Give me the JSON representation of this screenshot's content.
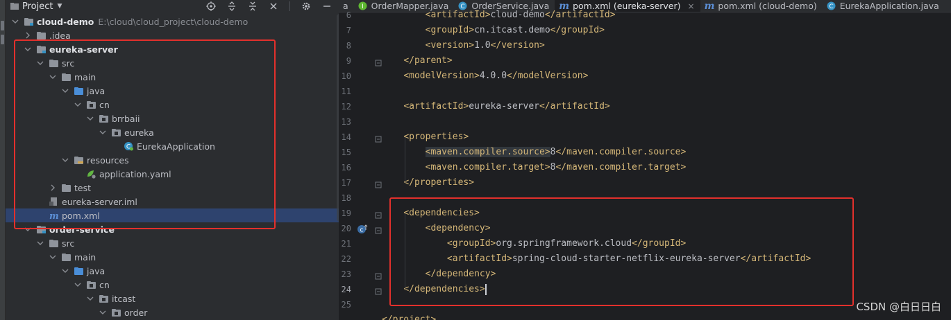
{
  "project_panel": {
    "title": "Project",
    "tree": [
      {
        "label": "cloud-demo",
        "path": "E:\\cloud\\cloud_project\\cloud-demo",
        "bold": true,
        "icon": "module-folder-icon",
        "expanded": true,
        "depth": 0
      },
      {
        "label": ".idea",
        "icon": "folder-icon",
        "expanded": false,
        "depth": 1
      },
      {
        "label": "eureka-server",
        "bold": true,
        "icon": "module-folder-icon",
        "expanded": true,
        "depth": 1
      },
      {
        "label": "src",
        "icon": "folder-icon",
        "expanded": true,
        "depth": 2
      },
      {
        "label": "main",
        "icon": "folder-icon",
        "expanded": true,
        "depth": 3
      },
      {
        "label": "java",
        "icon": "source-folder-icon",
        "expanded": true,
        "depth": 4
      },
      {
        "label": "cn",
        "icon": "package-icon",
        "expanded": true,
        "depth": 5
      },
      {
        "label": "brrbaii",
        "icon": "package-icon",
        "expanded": true,
        "depth": 6
      },
      {
        "label": "eureka",
        "icon": "package-icon",
        "expanded": true,
        "depth": 7
      },
      {
        "label": "EurekaApplication",
        "icon": "spring-class-icon",
        "depth": 8
      },
      {
        "label": "resources",
        "icon": "resources-folder-icon",
        "expanded": true,
        "depth": 4
      },
      {
        "label": "application.yaml",
        "icon": "yaml-spring-icon",
        "depth": 5
      },
      {
        "label": "test",
        "icon": "folder-icon",
        "expanded": false,
        "depth": 3
      },
      {
        "label": "eureka-server.iml",
        "icon": "iml-file-icon",
        "depth": 2
      },
      {
        "label": "pom.xml",
        "icon": "maven-file-icon",
        "depth": 2,
        "selected": true
      },
      {
        "label": "order-service",
        "bold": true,
        "icon": "module-folder-icon",
        "expanded": true,
        "depth": 1
      },
      {
        "label": "src",
        "icon": "folder-icon",
        "expanded": true,
        "depth": 2
      },
      {
        "label": "main",
        "icon": "folder-icon",
        "expanded": true,
        "depth": 3
      },
      {
        "label": "java",
        "icon": "source-folder-icon",
        "expanded": true,
        "depth": 4
      },
      {
        "label": "cn",
        "icon": "package-icon",
        "expanded": true,
        "depth": 5
      },
      {
        "label": "itcast",
        "icon": "package-icon",
        "expanded": true,
        "depth": 6
      },
      {
        "label": "order",
        "icon": "package-icon",
        "expanded": true,
        "depth": 7
      }
    ]
  },
  "editor": {
    "tabs": [
      {
        "label": "a",
        "icon": "none"
      },
      {
        "label": "OrderMapper.java",
        "icon": "interface-icon",
        "color": "#5fb832"
      },
      {
        "label": "OrderService.java",
        "icon": "class-icon",
        "color": "#3592c4"
      },
      {
        "label": "pom.xml (eureka-server)",
        "icon": "maven-m-icon",
        "active": true
      },
      {
        "label": "pom.xml (cloud-demo)",
        "icon": "maven-m-icon"
      },
      {
        "label": "EurekaApplication.java",
        "icon": "spring-class-icon",
        "color": "#3592c4"
      }
    ],
    "lines": [
      {
        "num": "6",
        "code": "        <artifactId>cloud-demo</artifactId>"
      },
      {
        "num": "7",
        "code": "        <groupId>cn.itcast.demo</groupId>"
      },
      {
        "num": "8",
        "code": "        <version>1.0</version>"
      },
      {
        "num": "9",
        "code": "    </parent>"
      },
      {
        "num": "10",
        "code": "    <modelVersion>4.0.0</modelVersion>"
      },
      {
        "num": "11",
        "code": ""
      },
      {
        "num": "12",
        "code": "    <artifactId>eureka-server</artifactId>"
      },
      {
        "num": "13",
        "code": ""
      },
      {
        "num": "14",
        "code": "    <properties>"
      },
      {
        "num": "15",
        "code": "        <maven.compiler.source>8</maven.compiler.source>"
      },
      {
        "num": "16",
        "code": "        <maven.compiler.target>8</maven.compiler.target>"
      },
      {
        "num": "17",
        "code": "    </properties>"
      },
      {
        "num": "18",
        "code": ""
      },
      {
        "num": "19",
        "code": "    <dependencies>"
      },
      {
        "num": "20",
        "code": "        <dependency>"
      },
      {
        "num": "21",
        "code": "            <groupId>org.springframework.cloud</groupId>"
      },
      {
        "num": "22",
        "code": "            <artifactId>spring-cloud-starter-netflix-eureka-server</artifactId>"
      },
      {
        "num": "23",
        "code": "        </dependency>"
      },
      {
        "num": "24",
        "code": "    </dependencies>"
      },
      {
        "num": "25",
        "code": ""
      },
      {
        "num": "",
        "code": "</project>"
      }
    ],
    "current_line": "24"
  },
  "watermark": "CSDN @白日日白",
  "colors": {
    "tag": "#d5b778",
    "text": "#bcbec4",
    "annotation_box": "#e3302c",
    "selection": "#2e436e"
  }
}
